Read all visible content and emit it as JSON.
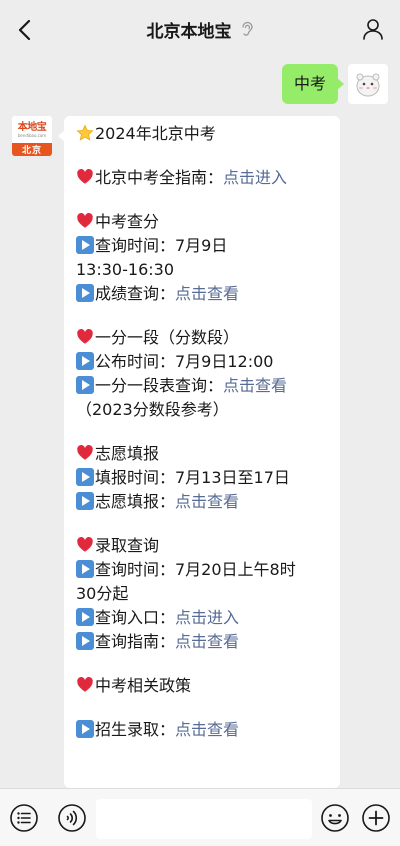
{
  "header": {
    "title": "北京本地宝",
    "back_icon": "chevron-left-icon",
    "ear_icon": "ear-icon",
    "profile_icon": "person-icon"
  },
  "outgoing_message": {
    "text": "中考",
    "bubble_color": "#95ec69"
  },
  "sender": {
    "brand_name": "本地宝",
    "brand_url": "bendibao.com",
    "city_tag": "北京",
    "accent_color": "#e8561f"
  },
  "incoming_message": {
    "link_color": "#576b95",
    "title": "2024年北京中考",
    "guide_label": "北京中考全指南：",
    "guide_link": "点击进入",
    "s1_heading": "中考查分",
    "s1_time_line1": "查询时间：7月9日",
    "s1_time_line2": "13:30-16:30",
    "s1_score_label": "成绩查询：",
    "s1_score_link": "点击查看",
    "s2_heading": "一分一段（分数段）",
    "s2_publish": "公布时间：7月9日12:00",
    "s2_table_label": "一分一段表查询：",
    "s2_table_link": "点击查看",
    "s2_ref": "（2023分数段参考）",
    "s3_heading": "志愿填报",
    "s3_time": "填报时间：7月13日至17日",
    "s3_fill_label": "志愿填报：",
    "s3_fill_link": "点击查看",
    "s4_heading": "录取查询",
    "s4_time_line1": "查询时间：7月20日上午8时",
    "s4_time_line2": "30分起",
    "s4_entry_label": "查询入口：",
    "s4_entry_link": "点击进入",
    "s4_guide_label": "查询指南：",
    "s4_guide_link": "点击查看",
    "s5_heading": "中考相关政策",
    "s5_enroll_label": "招生录取：",
    "s5_enroll_link": "点击查看"
  },
  "input_bar": {
    "menu_icon": "list-menu-icon",
    "voice_icon": "voice-icon",
    "emoji_icon": "smiley-icon",
    "add_icon": "plus-circle-icon",
    "input_value": ""
  }
}
